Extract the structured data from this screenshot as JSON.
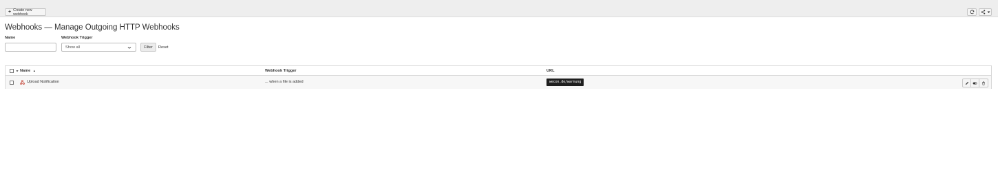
{
  "toolbar": {
    "create_label": "Create new webhook",
    "create_icon": "plus-icon",
    "refresh_icon": "refresh-icon",
    "share_icon": "share-icon"
  },
  "page": {
    "title": "Webhooks — Manage Outgoing HTTP Webhooks"
  },
  "filters": {
    "name_label": "Name",
    "name_value": "",
    "trigger_label": "Webhook Trigger",
    "trigger_selected": "Show all",
    "filter_button": "Filter",
    "reset_link": "Reset"
  },
  "table": {
    "columns": [
      "Name",
      "Webhook Trigger",
      "URL"
    ],
    "sort_indicator": "▲",
    "rows": [
      {
        "name": "Upload Notification",
        "trigger": "... when a file is added",
        "url": "wecon.de/warnung",
        "icon": "webhook-icon",
        "actions": [
          "edit-icon",
          "toggle-icon",
          "delete-icon"
        ]
      }
    ]
  },
  "colors": {
    "topbar": "#eeeeee",
    "webhook_icon": "#c0392b",
    "url_badge": "#1e1e1e"
  }
}
